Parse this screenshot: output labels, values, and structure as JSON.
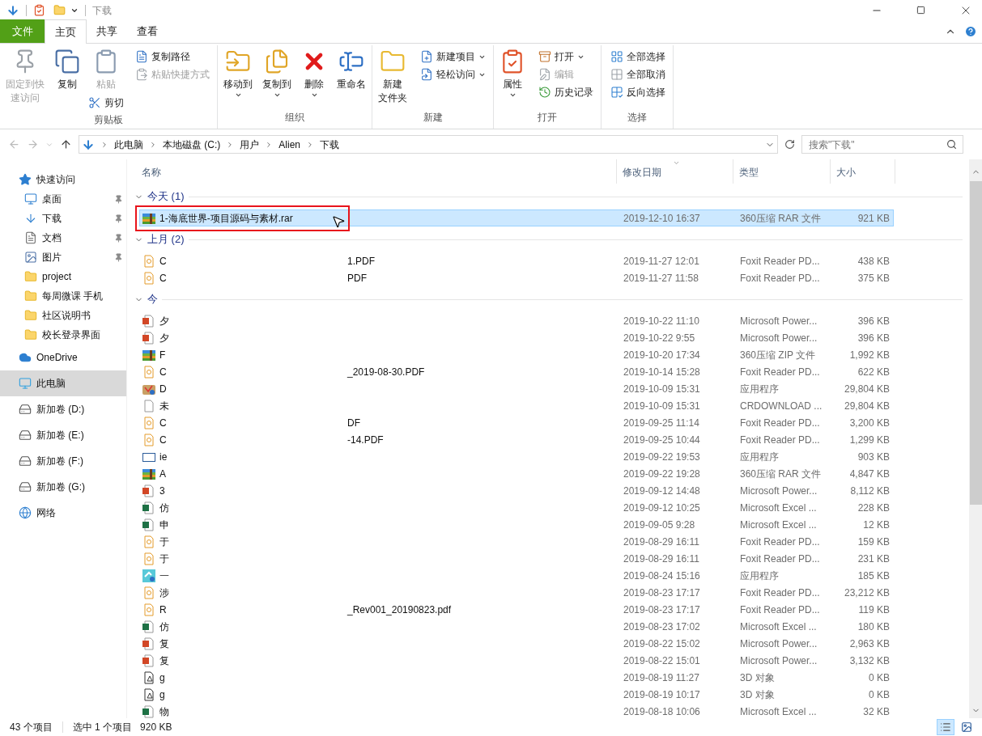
{
  "window": {
    "title": "下载"
  },
  "ribbon_tabs": [
    {
      "label": "文件",
      "kind": "file",
      "selected": false
    },
    {
      "label": "主页",
      "kind": "tab",
      "selected": true
    },
    {
      "label": "共享",
      "kind": "tab",
      "selected": false
    },
    {
      "label": "查看",
      "kind": "tab",
      "selected": false
    }
  ],
  "ribbon_groups": [
    {
      "label": "剪贴板",
      "columns": [
        [
          {
            "kind": "large",
            "label": [
              "固定到快",
              "速访问"
            ],
            "disabled": true,
            "dropdown": false
          }
        ],
        [
          {
            "kind": "large",
            "label": [
              "复制"
            ],
            "disabled": false,
            "dropdown": false
          }
        ],
        [
          {
            "kind": "large",
            "label": [
              "粘贴"
            ],
            "disabled": true,
            "dropdown": false
          },
          {
            "kind": "small",
            "label": [
              "剪切"
            ],
            "disabled": false,
            "dropdown": false
          }
        ],
        [
          {
            "kind": "small",
            "label": [
              "复制路径"
            ],
            "disabled": false,
            "dropdown": false
          },
          {
            "kind": "small",
            "label": [
              "粘贴快捷方式"
            ],
            "disabled": true,
            "dropdown": false
          }
        ]
      ]
    },
    {
      "label": "组织",
      "columns": [
        [
          {
            "kind": "large",
            "label": [
              "移动到"
            ],
            "disabled": false,
            "dropdown": true
          }
        ],
        [
          {
            "kind": "large",
            "label": [
              "复制到"
            ],
            "disabled": false,
            "dropdown": true
          }
        ],
        [
          {
            "kind": "large",
            "label": [
              "删除"
            ],
            "disabled": false,
            "dropdown": true
          }
        ],
        [
          {
            "kind": "large",
            "label": [
              "重命名"
            ],
            "disabled": false,
            "dropdown": false
          }
        ]
      ]
    },
    {
      "label": "新建",
      "columns": [
        [
          {
            "kind": "large",
            "label": [
              "新建",
              "文件夹"
            ],
            "disabled": false,
            "dropdown": false
          }
        ],
        [
          {
            "kind": "small",
            "label": [
              "新建项目"
            ],
            "disabled": false,
            "dropdown": true
          },
          {
            "kind": "small",
            "label": [
              "轻松访问"
            ],
            "disabled": false,
            "dropdown": true
          }
        ]
      ]
    },
    {
      "label": "打开",
      "columns": [
        [
          {
            "kind": "large",
            "label": [
              "属性"
            ],
            "disabled": false,
            "dropdown": true
          }
        ],
        [
          {
            "kind": "small",
            "label": [
              "打开"
            ],
            "disabled": false,
            "dropdown": true
          },
          {
            "kind": "small",
            "label": [
              "编辑"
            ],
            "disabled": true,
            "dropdown": false
          },
          {
            "kind": "small",
            "label": [
              "历史记录"
            ],
            "disabled": false,
            "dropdown": false
          }
        ]
      ]
    },
    {
      "label": "选择",
      "columns": [
        [
          {
            "kind": "small",
            "label": [
              "全部选择"
            ],
            "disabled": false,
            "dropdown": false
          },
          {
            "kind": "small",
            "label": [
              "全部取消"
            ],
            "disabled": false,
            "dropdown": false
          },
          {
            "kind": "small",
            "label": [
              "反向选择"
            ],
            "disabled": false,
            "dropdown": false
          }
        ]
      ]
    }
  ],
  "address": {
    "crumbs": [
      "此电脑",
      "本地磁盘 (C:)",
      "用户",
      "Alien",
      "下载"
    ]
  },
  "search": {
    "placeholder": "搜索\"下载\""
  },
  "sidebar": [
    {
      "label": "快速访问",
      "kind": "star",
      "selected": false,
      "children": [
        {
          "label": "桌面",
          "kind": "desktop",
          "pinned": true,
          "selected": false
        },
        {
          "label": "下载",
          "kind": "download",
          "pinned": true,
          "selected": false
        },
        {
          "label": "文档",
          "kind": "doc",
          "pinned": true,
          "selected": false
        },
        {
          "label": "图片",
          "kind": "pictures",
          "pinned": true,
          "selected": false
        },
        {
          "label": "project",
          "kind": "folder",
          "pinned": false,
          "selected": false
        },
        {
          "label": "每周微课 手机",
          "kind": "folder",
          "pinned": false,
          "selected": false
        },
        {
          "label": "社区说明书",
          "kind": "folder",
          "pinned": false,
          "selected": false
        },
        {
          "label": "校长登录界面",
          "kind": "folder",
          "pinned": false,
          "selected": false
        }
      ]
    },
    {
      "label": "OneDrive",
      "kind": "cloud",
      "selected": false
    },
    {
      "label": "此电脑",
      "kind": "pc",
      "selected": true
    },
    {
      "label": "新加卷 (D:)",
      "kind": "drive",
      "selected": false
    },
    {
      "label": "新加卷 (E:)",
      "kind": "drive",
      "selected": false
    },
    {
      "label": "新加卷 (F:)",
      "kind": "drive",
      "selected": false
    },
    {
      "label": "新加卷 (G:)",
      "kind": "drive",
      "selected": false
    },
    {
      "label": "网络",
      "kind": "network",
      "selected": false
    }
  ],
  "columns": [
    "名称",
    "修改日期",
    "类型",
    "大小"
  ],
  "groups": [
    {
      "label": "今天 (1)",
      "files": [
        {
          "kind": "archive",
          "name": "1-海底世界-项目源码与素材.rar",
          "date": "2019-12-10 16:37",
          "type": "360压缩 RAR 文件",
          "size": "921 KB",
          "selected": true
        }
      ]
    },
    {
      "label": "上月 (2)",
      "files": [
        {
          "kind": "pdf",
          "name": "C",
          "name_2": "1.PDF",
          "date": "2019-11-27 12:01",
          "type": "Foxit Reader PD...",
          "size": "438 KB",
          "selected": false
        },
        {
          "kind": "pdf",
          "name": "C",
          "name_2": "PDF",
          "date": "2019-11-27 11:58",
          "type": "Foxit Reader PD...",
          "size": "375 KB",
          "selected": false
        }
      ]
    },
    {
      "label": "今",
      "files": [
        {
          "kind": "ppt",
          "name": "夕",
          "date": "2019-10-22 11:10",
          "type": "Microsoft Power...",
          "size": "396 KB",
          "selected": false
        },
        {
          "kind": "ppt",
          "name": "夕",
          "date": "2019-10-22 9:55",
          "type": "Microsoft Power...",
          "size": "396 KB",
          "selected": false
        },
        {
          "kind": "archive",
          "name": "F",
          "date": "2019-10-20 17:34",
          "type": "360压缩 ZIP 文件",
          "size": "1,992 KB",
          "selected": false
        },
        {
          "kind": "pdf",
          "name": "C",
          "name_2": "_2019-08-30.PDF",
          "date": "2019-10-14 15:28",
          "type": "Foxit Reader PD...",
          "size": "622 KB",
          "selected": false
        },
        {
          "kind": "package",
          "name": "D",
          "date": "2019-10-09 15:31",
          "type": "应用程序",
          "size": "29,804 KB",
          "selected": false
        },
        {
          "kind": "blank",
          "name": "未",
          "date": "2019-10-09 15:31",
          "type": "CRDOWNLOAD ...",
          "size": "29,804 KB",
          "selected": false
        },
        {
          "kind": "pdf",
          "name": "C",
          "name_2": "DF",
          "date": "2019-09-25 11:14",
          "type": "Foxit Reader PD...",
          "size": "3,200 KB",
          "selected": false
        },
        {
          "kind": "pdf",
          "name": "C",
          "name_2": "-14.PDF",
          "date": "2019-09-25 10:44",
          "type": "Foxit Reader PD...",
          "size": "1,299 KB",
          "selected": false
        },
        {
          "kind": "window",
          "name": "ie",
          "date": "2019-09-22 19:53",
          "type": "应用程序",
          "size": "903 KB",
          "selected": false
        },
        {
          "kind": "archive",
          "name": "A",
          "date": "2019-09-22 19:28",
          "type": "360压缩 RAR 文件",
          "size": "4,847 KB",
          "selected": false
        },
        {
          "kind": "ppt",
          "name": "3",
          "date": "2019-09-12 14:48",
          "type": "Microsoft Power...",
          "size": "8,112 KB",
          "selected": false
        },
        {
          "kind": "excel",
          "name": "仿",
          "date": "2019-09-12 10:25",
          "type": "Microsoft Excel ...",
          "size": "228 KB",
          "selected": false
        },
        {
          "kind": "excel",
          "name": "申",
          "date": "2019-09-05 9:28",
          "type": "Microsoft Excel ...",
          "size": "12 KB",
          "selected": false
        },
        {
          "kind": "pdf",
          "name": "于",
          "date": "2019-08-29 16:11",
          "type": "Foxit Reader PD...",
          "size": "159 KB",
          "selected": false
        },
        {
          "kind": "pdf",
          "name": "于",
          "date": "2019-08-29 16:11",
          "type": "Foxit Reader PD...",
          "size": "231 KB",
          "selected": false
        },
        {
          "kind": "setup",
          "name": "一",
          "date": "2019-08-24 15:16",
          "type": "应用程序",
          "size": "185 KB",
          "selected": false
        },
        {
          "kind": "pdf",
          "name": "涉",
          "date": "2019-08-23 17:17",
          "type": "Foxit Reader PD...",
          "size": "23,212 KB",
          "selected": false
        },
        {
          "kind": "pdf",
          "name": "R",
          "name_2": "_Rev001_20190823.pdf",
          "date": "2019-08-23 17:17",
          "type": "Foxit Reader PD...",
          "size": "119 KB",
          "selected": false
        },
        {
          "kind": "excel",
          "name": "仿",
          "date": "2019-08-23 17:02",
          "type": "Microsoft Excel ...",
          "size": "180 KB",
          "selected": false
        },
        {
          "kind": "ppt",
          "name": "复",
          "date": "2019-08-22 15:02",
          "type": "Microsoft Power...",
          "size": "2,963 KB",
          "selected": false
        },
        {
          "kind": "ppt",
          "name": "复",
          "date": "2019-08-22 15:01",
          "type": "Microsoft Power...",
          "size": "3,132 KB",
          "selected": false
        },
        {
          "kind": "model",
          "name": "g",
          "date": "2019-08-19 11:27",
          "type": "3D 对象",
          "size": "0 KB",
          "selected": false
        },
        {
          "kind": "model",
          "name": "g",
          "date": "2019-08-19 10:17",
          "type": "3D 对象",
          "size": "0 KB",
          "selected": false
        },
        {
          "kind": "excel",
          "name": "物",
          "date": "2019-08-18 10:06",
          "type": "Microsoft Excel ...",
          "size": "32 KB",
          "selected": false
        }
      ]
    }
  ],
  "status": {
    "count": "43 个项目",
    "selection": "选中 1 个项目",
    "size": "920 KB"
  },
  "views": [
    {
      "kind": "details",
      "selected": true
    },
    {
      "kind": "preview",
      "selected": false
    }
  ]
}
